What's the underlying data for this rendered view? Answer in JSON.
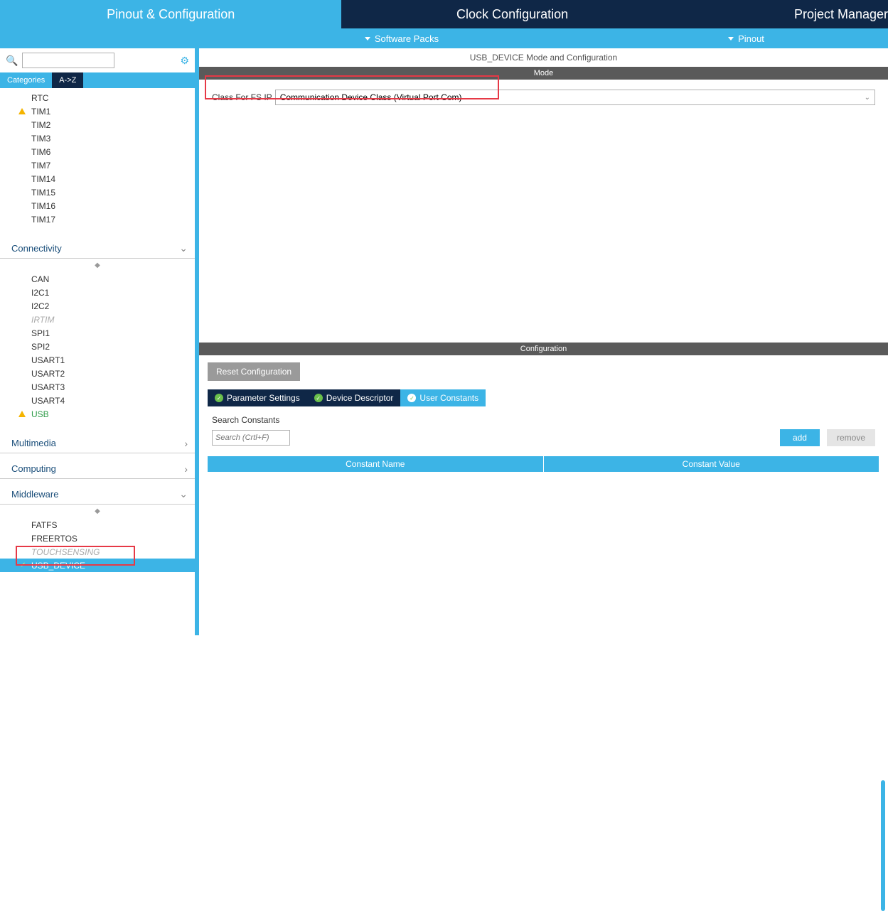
{
  "topTabs": {
    "pinout": "Pinout & Configuration",
    "clock": "Clock Configuration",
    "project": "Project Manager"
  },
  "subTabs": {
    "packs": "Software Packs",
    "pinout": "Pinout"
  },
  "catTabs": {
    "cat": "Categories",
    "az": "A->Z"
  },
  "timers": [
    "RTC",
    "TIM1",
    "TIM2",
    "TIM3",
    "TIM6",
    "TIM7",
    "TIM14",
    "TIM15",
    "TIM16",
    "TIM17"
  ],
  "sections": {
    "conn": "Connectivity",
    "mm": "Multimedia",
    "comp": "Computing",
    "mw": "Middleware"
  },
  "connItems": [
    "CAN",
    "I2C1",
    "I2C2",
    "IRTIM",
    "SPI1",
    "SPI2",
    "USART1",
    "USART2",
    "USART3",
    "USART4",
    "USB"
  ],
  "mwItems": [
    "FATFS",
    "FREERTOS",
    "TOUCHSENSING",
    "USB_DEVICE"
  ],
  "panelTitle": "USB_DEVICE Mode and Configuration",
  "modeBar": "Mode",
  "modeLabel": "Class For FS IP",
  "modeValue": "Communication Device Class (Virtual Port Com)",
  "configBar": "Configuration",
  "resetBtn": "Reset Configuration",
  "cfgTabs": {
    "param": "Parameter Settings",
    "dev": "Device Descriptor",
    "user": "User Constants"
  },
  "searchConst": "Search Constants",
  "searchPH": "Search (Crtl+F)",
  "addBtn": "add",
  "remBtn": "remove",
  "th1": "Constant Name",
  "th2": "Constant Value"
}
